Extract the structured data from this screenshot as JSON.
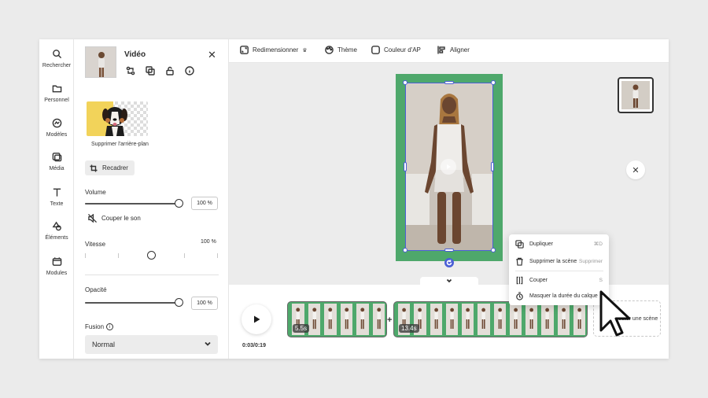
{
  "rail": {
    "items": [
      {
        "label": "Rechercher",
        "icon": "search-icon"
      },
      {
        "label": "Personnel",
        "icon": "folder-icon"
      },
      {
        "label": "Modèles",
        "icon": "templates-icon"
      },
      {
        "label": "Média",
        "icon": "media-icon"
      },
      {
        "label": "Texte",
        "icon": "text-icon"
      },
      {
        "label": "Éléments",
        "icon": "elements-icon"
      },
      {
        "label": "Modules",
        "icon": "modules-icon"
      }
    ]
  },
  "panel": {
    "title": "Vidéo",
    "tools": [
      "replace-icon",
      "duplicate-icon",
      "unlock-icon",
      "info-icon"
    ],
    "remove_bg_label": "Supprimer l'arrière-plan",
    "crop_label": "Recadrer",
    "volume": {
      "label": "Volume",
      "value": "100 %",
      "level": 1.0
    },
    "mute_label": "Couper le son",
    "speed": {
      "label": "Vitesse",
      "value": "100 %",
      "level": 0.5
    },
    "opacity": {
      "label": "Opacité",
      "value": "100 %",
      "level": 1.0
    },
    "blend": {
      "label": "Fusion",
      "selected": "Normal"
    }
  },
  "toolbar": {
    "resize_label": "Redimensionner",
    "theme_label": "Thème",
    "bg_color_label": "Couleur d'AP",
    "align_label": "Aligner"
  },
  "timeline": {
    "time": "0:03/0:19",
    "clips": [
      {
        "duration": "5.5s"
      },
      {
        "duration": "13.4s"
      }
    ],
    "add_scene_label": "Ajouter une scène"
  },
  "context_menu": {
    "items": [
      {
        "label": "Dupliquer",
        "shortcut": "⌘D",
        "icon": "duplicate-icon"
      },
      {
        "label": "Supprimer la scène",
        "shortcut": "Supprimer",
        "icon": "trash-icon"
      },
      {
        "label": "Couper",
        "shortcut": "S",
        "icon": "split-icon"
      },
      {
        "label": "Masquer la durée du calque",
        "shortcut": "",
        "icon": "hide-duration-icon"
      }
    ]
  },
  "colors": {
    "accent": "#4b5fd6",
    "scene_bg": "#4ea86b",
    "canvas_bg": "#ececec"
  }
}
